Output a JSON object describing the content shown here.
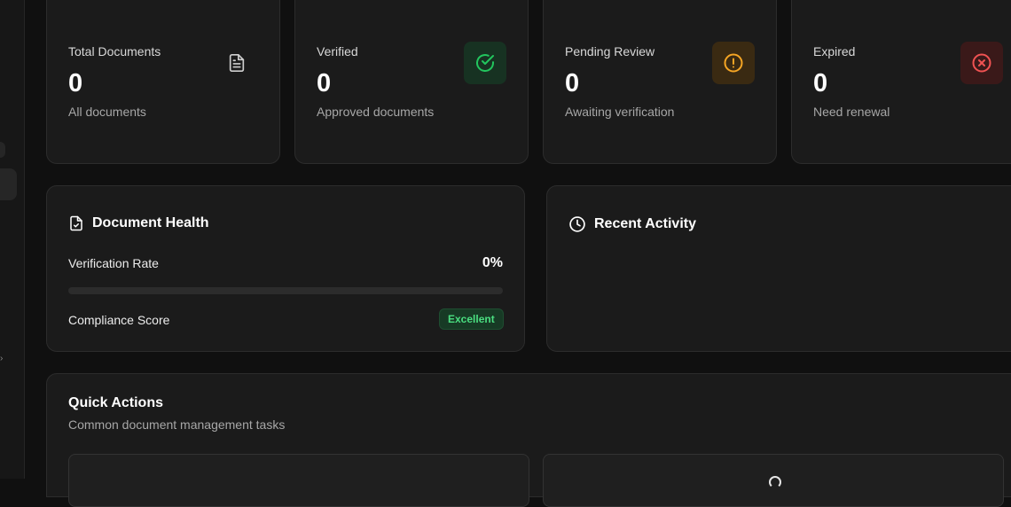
{
  "stats": [
    {
      "label": "Total Documents",
      "value": "0",
      "sub": "All documents",
      "icon": "file-text-icon"
    },
    {
      "label": "Verified",
      "value": "0",
      "sub": "Approved documents",
      "icon": "check-circle-icon",
      "color": "#22c55e"
    },
    {
      "label": "Pending Review",
      "value": "0",
      "sub": "Awaiting verification",
      "icon": "alert-circle-icon",
      "color": "#f59e0b"
    },
    {
      "label": "Expired",
      "value": "0",
      "sub": "Need renewal",
      "icon": "x-circle-icon",
      "color": "#ef4444"
    }
  ],
  "health": {
    "title": "Document Health",
    "verification_label": "Verification Rate",
    "verification_value": "0%",
    "verification_progress": 0,
    "compliance_label": "Compliance Score",
    "compliance_badge": "Excellent"
  },
  "activity": {
    "title": "Recent Activity"
  },
  "quick_actions": {
    "title": "Quick Actions",
    "subtitle": "Common document management tasks"
  }
}
